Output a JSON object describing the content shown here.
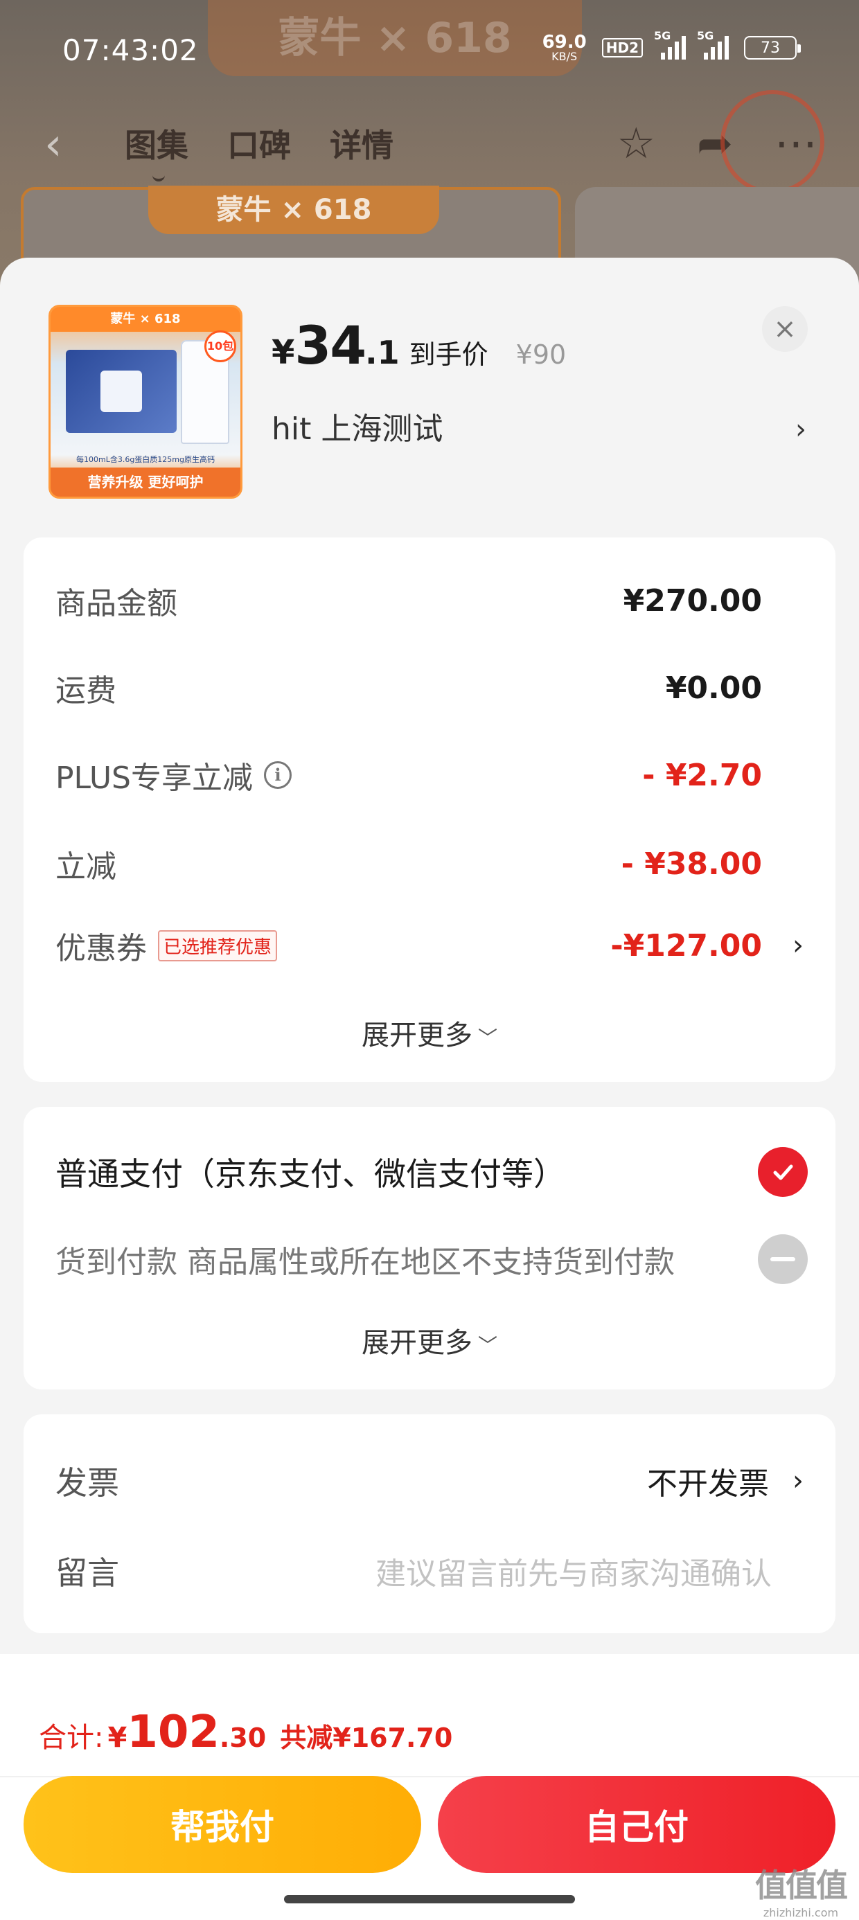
{
  "status_bar": {
    "time": "07:43:02",
    "net_speed_value": "69.0",
    "net_speed_unit": "KB/S",
    "hd_label": "HD2",
    "signal1_label": "5G",
    "signal2_label": "5G",
    "battery": "73"
  },
  "background": {
    "banner_text": "蒙牛 × 618",
    "nav_tabs": [
      "图集",
      "口碑",
      "详情"
    ],
    "card_tag": "蒙牛 × 618",
    "icons": [
      "chevron-left-icon",
      "star-icon",
      "share-icon",
      "more-icon"
    ]
  },
  "product": {
    "price_symbol": "¥",
    "price_integer": "34",
    "price_decimal": ".1",
    "price_tag": "到手价",
    "original_price": "¥90",
    "address": "hit  上海测试",
    "close_icon": "×",
    "chevron": "›",
    "thumb_top": "蒙牛 × 618",
    "thumb_badge": "10包",
    "thumb_spec": "每100mL含3.6g蛋白质125mg原生高钙",
    "thumb_slogan": "营养升级 更好呵护"
  },
  "fees": {
    "rows": [
      {
        "label": "商品金额",
        "value": "¥270.00"
      },
      {
        "label": "运费",
        "value": "¥0.00"
      },
      {
        "label": "PLUS专享立减",
        "value": "- ¥2.70"
      },
      {
        "label": "立减",
        "value": "- ¥38.00"
      },
      {
        "label": "优惠券",
        "tag": "已选推荐优惠",
        "value": "-¥127.00"
      }
    ],
    "expand_label": "展开更多"
  },
  "payment": {
    "options": [
      {
        "label": "普通支付（京东支付、微信支付等）",
        "selected": true
      },
      {
        "label": "货到付款 商品属性或所在地区不支持货到付款",
        "selected": false
      }
    ],
    "expand_label": "展开更多"
  },
  "misc": {
    "invoice_label": "发票",
    "invoice_value": "不开发票",
    "note_label": "留言",
    "note_placeholder": "建议留言前先与商家沟通确认"
  },
  "footer": {
    "total_label": "合计:",
    "total_symbol": "¥",
    "total_integer": "102",
    "total_decimal": ".30",
    "total_saved": "共减¥167.70",
    "btn_help": "帮我付",
    "btn_self": "自己付",
    "watermark_big": "值值值",
    "watermark_small": "zhizhizhi.com"
  },
  "colors": {
    "accent_red": "#e2231a",
    "button_yellow": "#ffb80e",
    "button_red": "#f0262e"
  }
}
